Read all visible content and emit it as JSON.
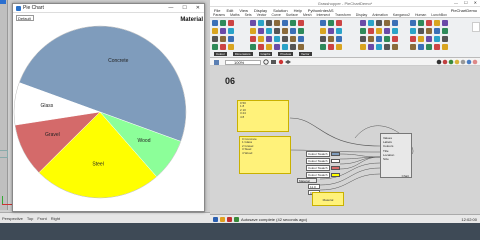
{
  "rhino": {
    "tabs": [
      "Perspective",
      "Top",
      "Front",
      "Right"
    ]
  },
  "pie_window": {
    "title": "Pie Chart",
    "controls": [
      "—",
      "☐",
      "✕"
    ],
    "dropdown": "Default",
    "chart_title": "Material"
  },
  "chart_data": {
    "type": "pie",
    "title": "Material",
    "slices": [
      {
        "label": "Concrete",
        "value": 50,
        "color": "#7f9cbc"
      },
      {
        "label": "Glass",
        "value": 8,
        "color": "#ffffff"
      },
      {
        "label": "Gravel",
        "value": 10,
        "color": "#d46a6a"
      },
      {
        "label": "Steel",
        "value": 24,
        "color": "#ffff00"
      },
      {
        "label": "Wood",
        "value": 8,
        "color": "#8cff99"
      }
    ]
  },
  "grasshopper": {
    "title": "Grasshopper - PieChartDemo*",
    "window_controls": [
      "—",
      "☐",
      "✕"
    ],
    "menu": [
      "File",
      "Edit",
      "View",
      "Display",
      "Solution",
      "Help",
      "PythonInterAS"
    ],
    "menu_right": "PieChartDemo",
    "ribbon_tabs": [
      "Params",
      "Maths",
      "Sets",
      "Vector",
      "Curve",
      "Surface",
      "Mesh",
      "Intersect",
      "Transform",
      "Display",
      "Animation",
      "Kangaroo2",
      "Human",
      "LunchBox"
    ],
    "ribbon_groups": [
      "Colour",
      "Dimensions",
      "Graphs",
      "Preview",
      "Vector"
    ],
    "zoom": "100%",
    "group_number": "06",
    "panel1_lines": [
      "0 50",
      "1 8",
      "2 10",
      "3 24",
      "4 8"
    ],
    "panel2_lines": [
      "0 Concrete",
      "1 Glass",
      "2 Gravel",
      "3 Steel",
      "4 Wood"
    ],
    "component_inputs": [
      "Values",
      "Labels",
      "Colours",
      "Title",
      "Location",
      "Size"
    ],
    "component_outputs": [
      "Chart"
    ],
    "swatch_labels": [
      "Colour Swatch",
      "Colour Swatch",
      "Colour Swatch",
      "Colour Swatch"
    ],
    "swatch_colors": [
      "#7f9cbc",
      "#ffffff",
      "#d46a6a",
      "#ffff00"
    ],
    "text_input_label": "Material",
    "slider_values": [
      "11.0",
      "0.0"
    ],
    "yellow_box": "Material",
    "status_text": "Autosave complete (42 seconds ago)",
    "status_time": "12:02:00"
  }
}
